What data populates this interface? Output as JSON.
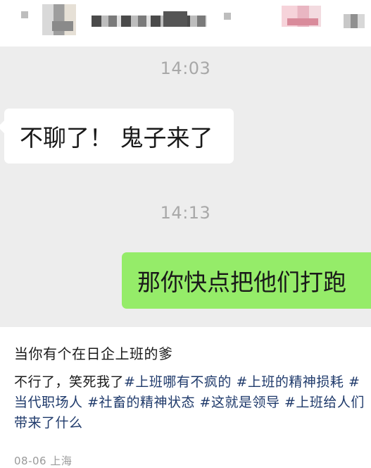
{
  "chat": {
    "messages": [
      {
        "kind": "timestamp",
        "text": "14:03"
      },
      {
        "kind": "incoming",
        "text": "不聊了！ 鬼子来了"
      },
      {
        "kind": "timestamp",
        "text": "14:13"
      },
      {
        "kind": "outgoing",
        "text": "那你快点把他们打跑"
      }
    ]
  },
  "post": {
    "title": "当你有个在日企上班的爹",
    "body_prefix": "不行了，笑死我了",
    "tags": [
      "#上班哪有不疯的",
      "#上班的精神损耗",
      "#当代职场人",
      "#社畜的精神状态",
      "#这就是领导",
      "#上班给人们带来了什么"
    ],
    "date": "08-06",
    "location": "上海"
  },
  "colors": {
    "chat_bg": "#ededed",
    "outgoing_bubble": "#95ec69",
    "incoming_bubble": "#ffffff",
    "tag_text": "#1f3a6b"
  }
}
